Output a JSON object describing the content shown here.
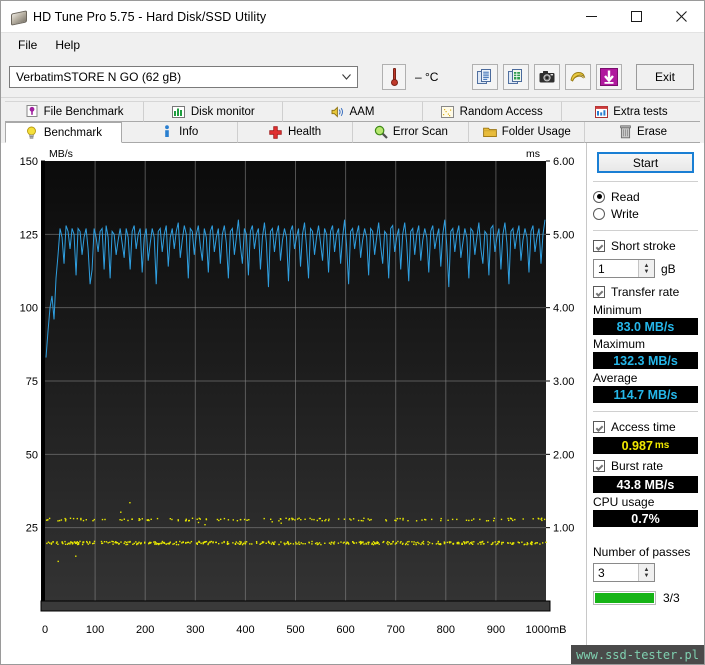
{
  "window": {
    "title": "HD Tune Pro 5.75 - Hard Disk/SSD Utility",
    "minimize": "minimize-icon",
    "maximize": "maximize-icon",
    "close": "close-icon"
  },
  "menu": {
    "items": [
      "File",
      "Help"
    ]
  },
  "toolbar": {
    "device": "VerbatimSTORE N GO (62 gB)",
    "temperature": "–  °C",
    "buttons": [
      {
        "name": "copy-report-icon",
        "label": ""
      },
      {
        "name": "export-excel-icon",
        "label": ""
      },
      {
        "name": "screenshot-icon",
        "label": ""
      },
      {
        "name": "folder-gold-icon",
        "label": ""
      },
      {
        "name": "save-download-icon",
        "label": ""
      }
    ],
    "exit_label": "Exit"
  },
  "tabs": {
    "row1": [
      {
        "label": "File Benchmark",
        "icon": "file-benchmark-icon",
        "active": false
      },
      {
        "label": "Disk monitor",
        "icon": "disk-monitor-icon",
        "active": false
      },
      {
        "label": "AAM",
        "icon": "speaker-icon",
        "active": false
      },
      {
        "label": "Random Access",
        "icon": "random-access-icon",
        "active": false
      },
      {
        "label": "Extra tests",
        "icon": "extra-tests-icon",
        "active": false
      }
    ],
    "row2": [
      {
        "label": "Benchmark",
        "icon": "bulb-icon",
        "active": true
      },
      {
        "label": "Info",
        "icon": "info-icon",
        "active": false
      },
      {
        "label": "Health",
        "icon": "health-cross-icon",
        "active": false
      },
      {
        "label": "Error Scan",
        "icon": "magnifier-icon",
        "active": false
      },
      {
        "label": "Folder Usage",
        "icon": "folder-icon",
        "active": false
      },
      {
        "label": "Erase",
        "icon": "trash-icon",
        "active": false
      }
    ]
  },
  "sidebar": {
    "start_label": "Start",
    "mode": {
      "read_label": "Read",
      "write_label": "Write",
      "selected": "Read"
    },
    "short_stroke": {
      "label": "Short stroke",
      "checked": true,
      "value": "1",
      "unit": "gB"
    },
    "transfer_rate": {
      "label": "Transfer rate",
      "checked": true
    },
    "minimum": {
      "label": "Minimum",
      "value": "83.0 MB/s"
    },
    "maximum": {
      "label": "Maximum",
      "value": "132.3 MB/s"
    },
    "average": {
      "label": "Average",
      "value": "114.7 MB/s"
    },
    "access_time": {
      "label": "Access time",
      "checked": true,
      "value": "0.987",
      "unit": "ms"
    },
    "burst_rate": {
      "label": "Burst rate",
      "checked": true,
      "value": "43.8 MB/s"
    },
    "cpu_usage": {
      "label": "CPU usage",
      "value": "0.7%"
    },
    "passes": {
      "label": "Number of passes",
      "value": "3",
      "progress_text": "3/3",
      "progress_percent": 100
    }
  },
  "watermark": "www.ssd-tester.pl",
  "colors": {
    "transfer_line": "#2f9fe0",
    "access_dots": "#e8e800",
    "plot_bg_top": "#0b0b0b",
    "plot_bg_bottom": "#333333",
    "grid": "#8c8c8c",
    "accent": "#1a7fd4",
    "progress": "#16b416"
  },
  "chart_data": {
    "type": "line",
    "title": "",
    "ylabel": "MB/s",
    "ylabel_right": "ms",
    "xlabel": "1000mB",
    "xlim": [
      0,
      1000
    ],
    "xticks": [
      0,
      100,
      200,
      300,
      400,
      500,
      600,
      700,
      800,
      900,
      1000
    ],
    "xticklabels": [
      "0",
      "100",
      "200",
      "300",
      "400",
      "500",
      "600",
      "700",
      "800",
      "900",
      "1000mB"
    ],
    "ylim": [
      0,
      150
    ],
    "yticks": [
      0,
      25,
      50,
      75,
      100,
      125,
      150
    ],
    "yticklabels": [
      "0",
      "25",
      "50",
      "75",
      "100",
      "125",
      "150"
    ],
    "ylim_right": [
      0,
      6
    ],
    "yticks_right": [
      1,
      2,
      3,
      4,
      5,
      6
    ],
    "yticklabels_right": [
      "1.00",
      "2.00",
      "3.00",
      "4.00",
      "5.00",
      "6.00"
    ],
    "grid": true,
    "legend": "none",
    "series": [
      {
        "name": "Transfer rate",
        "type": "line",
        "color": "#2f9fe0",
        "axis": "left",
        "unit": "MB/s",
        "summary": {
          "minimum": 83.0,
          "maximum": 132.3,
          "average": 114.7
        },
        "x": [
          2,
          6,
          10,
          14,
          18,
          22,
          26,
          30,
          34,
          38,
          42,
          46,
          50,
          54,
          58,
          62,
          66,
          70,
          74,
          78,
          82,
          86,
          90,
          94,
          98,
          102,
          106,
          110,
          114,
          118,
          122,
          126,
          130,
          134,
          138,
          142,
          146,
          150,
          154,
          158,
          162,
          166,
          170,
          174,
          178,
          182,
          186,
          190,
          194,
          198,
          202,
          206,
          210,
          214,
          218,
          222,
          226,
          230,
          234,
          238,
          242,
          246,
          250,
          254,
          258,
          262,
          266,
          270,
          274,
          278,
          282,
          286,
          290,
          294,
          298,
          302,
          306,
          310,
          314,
          318,
          322,
          326,
          330,
          334,
          338,
          342,
          346,
          350,
          354,
          358,
          362,
          366,
          370,
          374,
          378,
          382,
          386,
          390,
          394,
          398,
          402,
          406,
          410,
          414,
          418,
          422,
          426,
          430,
          434,
          438,
          442,
          446,
          450,
          454,
          458,
          462,
          466,
          470,
          474,
          478,
          482,
          486,
          490,
          494,
          498,
          502,
          506,
          510,
          514,
          518,
          522,
          526,
          530,
          534,
          538,
          542,
          546,
          550,
          554,
          558,
          562,
          566,
          570,
          574,
          578,
          582,
          586,
          590,
          594,
          598,
          602,
          606,
          610,
          614,
          618,
          622,
          626,
          630,
          634,
          638,
          642,
          646,
          650,
          654,
          658,
          662,
          666,
          670,
          674,
          678,
          682,
          686,
          690,
          694,
          698,
          702,
          706,
          710,
          714,
          718,
          722,
          726,
          730,
          734,
          738,
          742,
          746,
          750,
          754,
          758,
          762,
          766,
          770,
          774,
          778,
          782,
          786,
          790,
          794,
          798,
          802,
          806,
          810,
          814,
          818,
          822,
          826,
          830,
          834,
          838,
          842,
          846,
          850,
          854,
          858,
          862,
          866,
          870,
          874,
          878,
          882,
          886,
          890,
          894,
          898,
          902,
          906,
          910,
          914,
          918,
          922,
          926,
          930,
          934,
          938,
          942,
          946,
          950,
          954,
          958,
          962,
          966,
          970,
          974,
          978,
          982,
          986,
          990,
          994,
          998
        ],
        "y": [
          83,
          92,
          100,
          104,
          96,
          110,
          118,
          127,
          124,
          115,
          128,
          126,
          120,
          127,
          125,
          111,
          127,
          126,
          118,
          124,
          127,
          120,
          108,
          113,
          127,
          124,
          119,
          126,
          127,
          113,
          128,
          124,
          110,
          126,
          125,
          118,
          123,
          127,
          122,
          117,
          127,
          124,
          113,
          126,
          128,
          120,
          125,
          127,
          112,
          124,
          127,
          116,
          122,
          127,
          124,
          108,
          126,
          127,
          119,
          125,
          128,
          114,
          124,
          127,
          120,
          126,
          129,
          117,
          123,
          128,
          125,
          110,
          127,
          126,
          118,
          125,
          128,
          121,
          116,
          127,
          124,
          112,
          126,
          128,
          119,
          124,
          127,
          115,
          125,
          128,
          122,
          110,
          126,
          127,
          118,
          124,
          130,
          121,
          115,
          127,
          125,
          111,
          126,
          128,
          120,
          125,
          127,
          113,
          124,
          129,
          122,
          107,
          126,
          127,
          119,
          125,
          128,
          116,
          123,
          127,
          124,
          109,
          126,
          128,
          120,
          124,
          127,
          114,
          125,
          129,
          121,
          110,
          127,
          126,
          118,
          124,
          128,
          122,
          116,
          127,
          125,
          112,
          126,
          128,
          119,
          125,
          127,
          115,
          124,
          130,
          121,
          108,
          126,
          127,
          120,
          125,
          128,
          117,
          123,
          127,
          124,
          111,
          127,
          126,
          118,
          124,
          129,
          121,
          115,
          126,
          125,
          110,
          127,
          128,
          119,
          124,
          127,
          113,
          125,
          129,
          122,
          109,
          126,
          127,
          118,
          125,
          128,
          116,
          123,
          127,
          124,
          112,
          126,
          128,
          120,
          124,
          127,
          114,
          125,
          130,
          121,
          107,
          126,
          127,
          119,
          125,
          128,
          117,
          122,
          127,
          124,
          110,
          127,
          126,
          118,
          124,
          129,
          120,
          115,
          126,
          125,
          111,
          127,
          128,
          119,
          124,
          127,
          113,
          125,
          129,
          122,
          108,
          126,
          127,
          120,
          125,
          128,
          116,
          123,
          127,
          124,
          112,
          126,
          128,
          119,
          124,
          127,
          115,
          125,
          130,
          121,
          109,
          126,
          127,
          118,
          124,
          128,
          117,
          122,
          127,
          124,
          111,
          126,
          125,
          118,
          124,
          128,
          120
        ]
      },
      {
        "name": "Access time",
        "type": "scatter",
        "color": "#e8e800",
        "axis": "right",
        "unit": "ms",
        "summary": {
          "average_ms": 0.987
        },
        "cluster_main_ms": 0.8,
        "cluster_secondary_ms": 1.12,
        "note": "two horizontal dot bands spanning full width"
      }
    ]
  }
}
